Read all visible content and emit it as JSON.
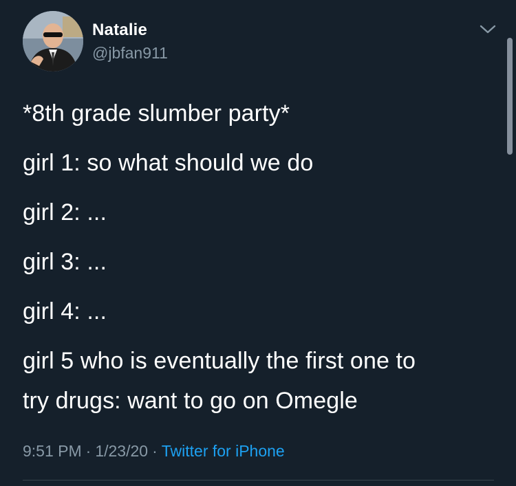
{
  "tweet": {
    "author": {
      "display_name": "Natalie",
      "handle": "@jbfan911",
      "avatar_icon": "profile-photo"
    },
    "lines": [
      "*8th grade slumber party*",
      "girl 1: so what should we do",
      "girl 2: ...",
      "girl 3: ...",
      "girl 4: ...",
      "girl 5 who is eventually the first one to",
      "try drugs: want to go on Omegle"
    ],
    "time": "9:51 PM",
    "date": "1/23/20",
    "separator": "·",
    "source": "Twitter for iPhone",
    "menu_icon": "chevron-down-icon"
  },
  "theme": {
    "background": "#15202b",
    "text": "#ffffff",
    "secondary_text": "#8899a6",
    "link": "#1da1f2",
    "divider": "#38444d"
  }
}
